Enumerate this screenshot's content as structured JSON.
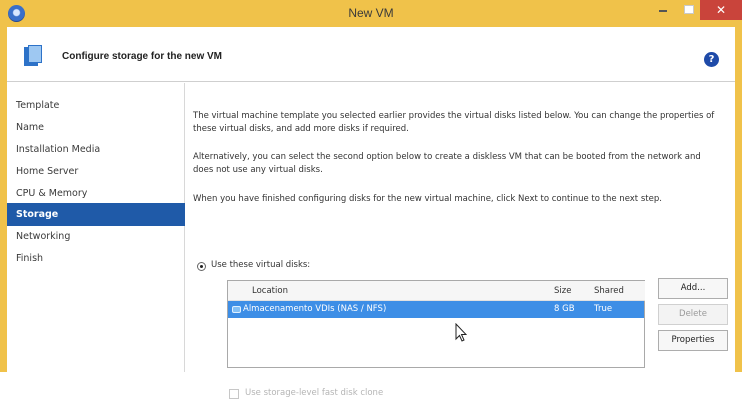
{
  "window": {
    "title": "New VM",
    "close_glyph": "✕"
  },
  "header": {
    "title": "Configure storage for the new VM",
    "help_glyph": "?"
  },
  "sidebar": {
    "items": [
      {
        "label": "Template"
      },
      {
        "label": "Name"
      },
      {
        "label": "Installation Media"
      },
      {
        "label": "Home Server"
      },
      {
        "label": "CPU & Memory"
      },
      {
        "label": "Storage",
        "active": true
      },
      {
        "label": "Networking"
      },
      {
        "label": "Finish"
      }
    ]
  },
  "main": {
    "paragraphs": [
      "The virtual machine template you selected earlier provides the virtual disks listed below. You can change the properties of these virtual disks, and add more disks if required.",
      "Alternatively, you can select the second option below to create a diskless VM that can be booted from the network and does not use any virtual disks.",
      "When you have finished configuring disks for the new virtual machine, click Next to continue to the next step."
    ],
    "use_disks_label": "Use these virtual disks:",
    "table": {
      "columns": [
        "Location",
        "Size",
        "Shared"
      ],
      "rows": [
        {
          "location": "Almacenamento VDIs (NAS / NFS)",
          "size": "8 GB",
          "shared": "True",
          "selected": true
        }
      ]
    },
    "buttons": {
      "add": "Add...",
      "delete": "Delete",
      "properties": "Properties"
    },
    "fast_clone_label": "Use storage-level fast disk clone"
  },
  "colors": {
    "titlebar": "#f0c24a",
    "selection": "#3d8ee6",
    "nav_active": "#1f5aa8",
    "close_button": "#c9443b"
  },
  "icons": [
    "app-icon",
    "wizard-storage-icon",
    "help-icon",
    "disk-icon",
    "mouse-cursor-icon"
  ]
}
